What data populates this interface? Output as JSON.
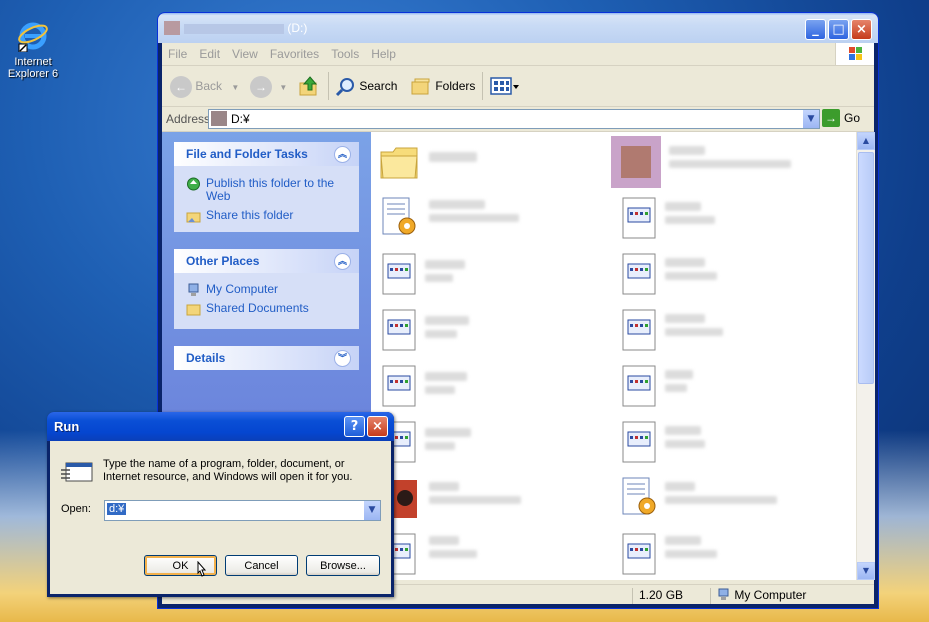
{
  "desktop": {
    "icon_label": "Internet Explorer 6"
  },
  "explorer": {
    "title_suffix": "(D:)",
    "menu": [
      "File",
      "Edit",
      "View",
      "Favorites",
      "Tools",
      "Help"
    ],
    "toolbar": {
      "back": "Back",
      "search": "Search",
      "folders": "Folders"
    },
    "address": {
      "label": "Address",
      "value": "D:¥",
      "go": "Go"
    },
    "tasks": {
      "file_folder_title": "File and Folder Tasks",
      "publish": "Publish this folder to the Web",
      "share": "Share this folder",
      "other_places_title": "Other Places",
      "my_computer": "My Computer",
      "shared_documents": "Shared Documents",
      "details_title": "Details"
    },
    "status": {
      "size": "1.20 GB",
      "location": "My Computer"
    }
  },
  "run_dialog": {
    "title": "Run",
    "description": "Type the name of a program, folder, document, or Internet resource, and Windows will open it for you.",
    "open_label": "Open:",
    "open_value": "d:¥",
    "ok": "OK",
    "cancel": "Cancel",
    "browse": "Browse..."
  },
  "colors": {
    "xp_blue": "#0a4fd6",
    "taskpane_link": "#215dc6",
    "selection": "#316ac5"
  }
}
